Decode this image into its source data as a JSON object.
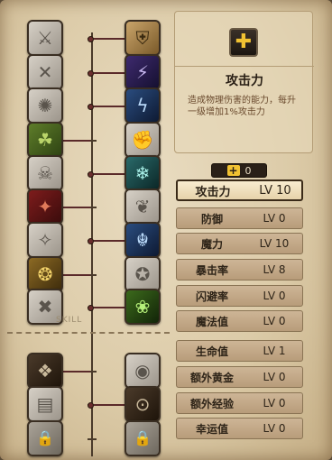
{
  "skill_tree": {
    "label": "SKILL",
    "left_column": [
      {
        "name": "sword-slash-icon",
        "color": "grey",
        "glyph": "⚔"
      },
      {
        "name": "double-slash-icon",
        "color": "grey",
        "glyph": "✕"
      },
      {
        "name": "whirlwind-icon",
        "color": "grey",
        "glyph": "✺"
      },
      {
        "name": "serpent-icon",
        "color": "green",
        "glyph": "☘"
      },
      {
        "name": "skull-icon",
        "color": "grey",
        "glyph": "☠"
      },
      {
        "name": "blade-fire-icon",
        "color": "red",
        "glyph": "✦"
      },
      {
        "name": "claw-icon",
        "color": "grey",
        "glyph": "✧"
      },
      {
        "name": "golden-beast-icon",
        "color": "gold",
        "glyph": "❂"
      },
      {
        "name": "cross-blades-icon",
        "color": "grey",
        "glyph": "✖"
      },
      {
        "name": "crimson-tome-icon",
        "color": "dark",
        "glyph": "❖"
      },
      {
        "name": "stone-tome-icon",
        "color": "grey",
        "glyph": "▤"
      },
      {
        "name": "lock-icon",
        "color": "locked",
        "glyph": "🔒"
      }
    ],
    "right_column": [
      {
        "name": "shield-emblem-icon",
        "color": "warm",
        "glyph": "⛨"
      },
      {
        "name": "arcane-strike-icon",
        "color": "purple",
        "glyph": "⚡"
      },
      {
        "name": "lightning-icon",
        "color": "blue",
        "glyph": "ϟ"
      },
      {
        "name": "gauntlet-icon",
        "color": "grey",
        "glyph": "✊"
      },
      {
        "name": "ice-shard-icon",
        "color": "teal",
        "glyph": "❄"
      },
      {
        "name": "wing-icon",
        "color": "grey",
        "glyph": "❦"
      },
      {
        "name": "frost-dragon-icon",
        "color": "blue",
        "glyph": "☬"
      },
      {
        "name": "stone-golem-icon",
        "color": "grey",
        "glyph": "✪"
      },
      {
        "name": "green-spirit-icon",
        "color": "lime",
        "glyph": "❀"
      },
      {
        "name": "eye-rune-icon",
        "color": "grey",
        "glyph": "◉"
      },
      {
        "name": "golden-eye-icon",
        "color": "dark",
        "glyph": "⊙"
      },
      {
        "name": "lock-icon",
        "color": "locked",
        "glyph": "🔒"
      }
    ]
  },
  "info_panel": {
    "icon": "plus-icon",
    "title": "攻击力",
    "description": "造成物理伤害的能力，每升一级增加1%攻击力"
  },
  "points": {
    "icon": "plus-icon",
    "value": "0"
  },
  "stats": [
    {
      "name": "攻击力",
      "level": "LV 10",
      "selected": true
    },
    {
      "name": "防御",
      "level": "LV 0",
      "selected": false
    },
    {
      "name": "魔力",
      "level": "LV 10",
      "selected": false
    },
    {
      "name": "暴击率",
      "level": "LV 8",
      "selected": false
    },
    {
      "name": "闪避率",
      "level": "LV 0",
      "selected": false
    },
    {
      "name": "魔法值",
      "level": "LV 0",
      "selected": false
    },
    {
      "name": "生命值",
      "level": "LV 1",
      "selected": false
    },
    {
      "name": "额外黄金",
      "level": "LV 0",
      "selected": false
    },
    {
      "name": "额外经验",
      "level": "LV 0",
      "selected": false
    },
    {
      "name": "幸运值",
      "level": "LV 0",
      "selected": false
    }
  ]
}
